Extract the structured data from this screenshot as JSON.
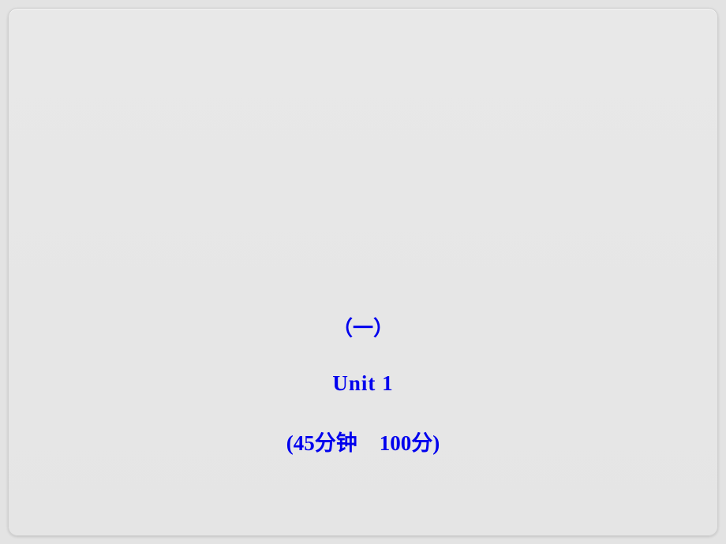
{
  "slide": {
    "line1": "（一）",
    "line2": "Unit  1",
    "line3_part1": "(45",
    "line3_cjk1": "分钟",
    "line3_part2": "100",
    "line3_cjk2": "分",
    "line3_part3": ")"
  }
}
